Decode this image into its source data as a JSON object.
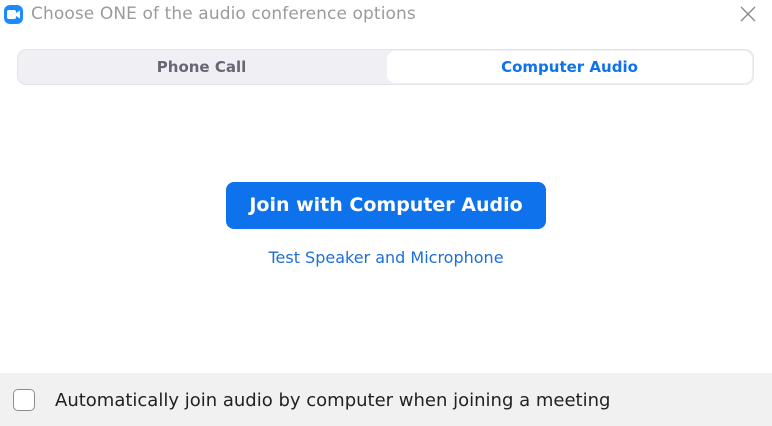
{
  "window": {
    "title": "Choose ONE of the audio conference options",
    "app_icon": "video-camera-icon",
    "close_icon": "close-icon"
  },
  "tabs": [
    {
      "label": "Phone Call",
      "selected": false
    },
    {
      "label": "Computer Audio",
      "selected": true
    }
  ],
  "main": {
    "join_button_label": "Join with Computer Audio",
    "test_link_label": "Test Speaker and Microphone"
  },
  "footer": {
    "auto_join_label": "Automatically join audio by computer when joining a meeting",
    "auto_join_checked": false
  },
  "colors": {
    "accent": "#0e72ed",
    "tab_inactive_text": "#676774",
    "footer_bg": "#f1f1f1"
  }
}
